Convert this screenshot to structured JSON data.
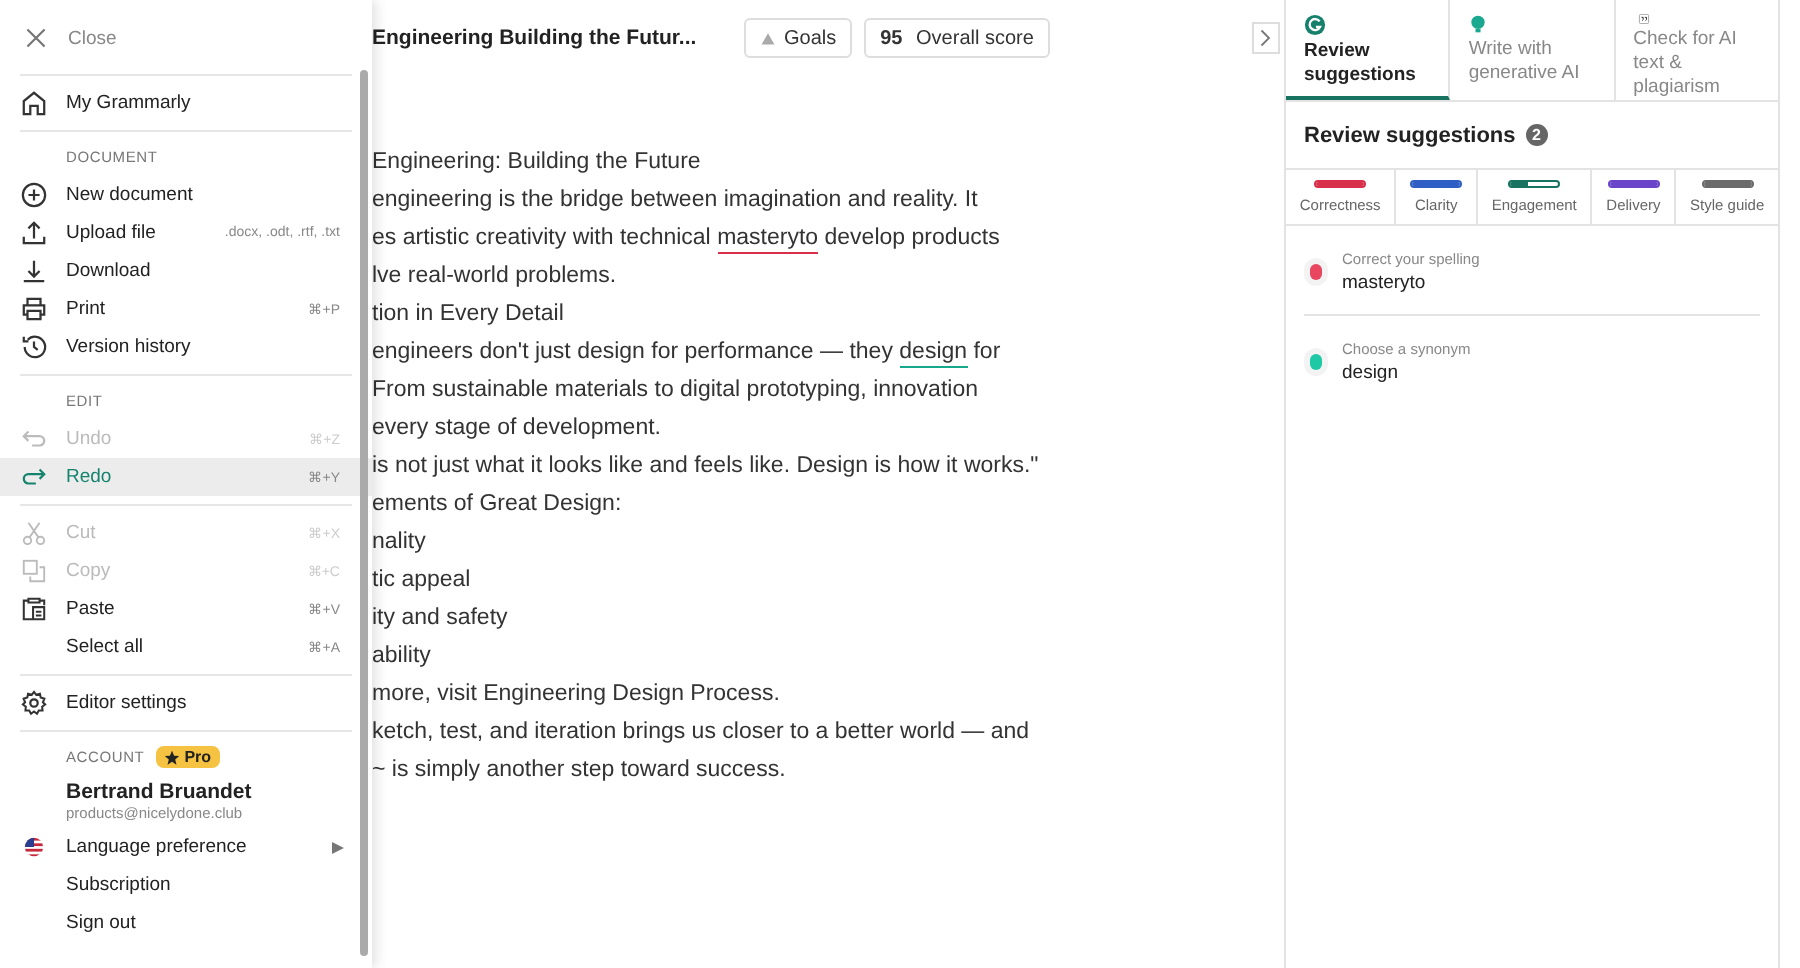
{
  "menu": {
    "close": "Close",
    "sections": [
      {
        "items": [
          {
            "label": "My Grammarly",
            "disabled": false,
            "selected": false
          }
        ]
      },
      {
        "header": "DOCUMENT",
        "items": [
          {
            "label": "New document",
            "disabled": false,
            "selected": false
          },
          {
            "label": "Upload file",
            "hint": ".docx, .odt, .rtf, .txt",
            "disabled": false,
            "selected": false
          },
          {
            "label": "Download",
            "disabled": false,
            "selected": false
          },
          {
            "label": "Print",
            "shortcut": "⌘+P",
            "disabled": false,
            "selected": false
          },
          {
            "label": "Version history",
            "disabled": false,
            "selected": false
          }
        ]
      },
      {
        "header": "EDIT",
        "items": [
          {
            "label": "Undo",
            "shortcut": "⌘+Z",
            "disabled": true,
            "selected": false
          },
          {
            "label": "Redo",
            "shortcut": "⌘+Y",
            "disabled": false,
            "selected": true
          }
        ]
      },
      {
        "items": [
          {
            "label": "Cut",
            "shortcut": "⌘+X",
            "disabled": true,
            "selected": false
          },
          {
            "label": "Copy",
            "shortcut": "⌘+C",
            "disabled": true,
            "selected": false
          },
          {
            "label": "Paste",
            "shortcut": "⌘+V",
            "disabled": false,
            "selected": false
          },
          {
            "label": "Select all",
            "shortcut": "⌘+A",
            "disabled": false,
            "selected": false
          }
        ]
      },
      {
        "items": [
          {
            "label": "Editor settings",
            "disabled": false,
            "selected": false
          }
        ]
      }
    ],
    "account": {
      "header": "ACCOUNT",
      "badge": "Pro",
      "name": "Bertrand Bruandet",
      "email": "products@nicelydone.club",
      "items": [
        {
          "label": "Language preference",
          "submenu": true
        },
        {
          "label": "Subscription",
          "submenu": false
        },
        {
          "label": "Sign out",
          "submenu": false
        }
      ]
    }
  },
  "editor": {
    "title": "Engineering Building the Futur...",
    "goals": "Goals",
    "score": "95",
    "score_label": "Overall score",
    "lines": [
      [
        {
          "text": "Engineering: Building the Future"
        }
      ],
      [
        {
          "text": "engineering is the bridge between imagination and reality. It"
        }
      ],
      [
        {
          "text": "es artistic creativity with technical "
        },
        {
          "text": "masteryto",
          "color": "#d8304a"
        },
        {
          "text": " develop products"
        }
      ],
      [
        {
          "text": "lve real-world problems."
        }
      ],
      [
        {
          "text": "tion in Every Detail"
        }
      ],
      [
        {
          "text": "engineers don't just design for performance — they "
        },
        {
          "text": "design",
          "color": "#15a88a"
        },
        {
          "text": " for"
        }
      ],
      [
        {
          "text": "From sustainable materials to digital prototyping, innovation"
        }
      ],
      [
        {
          "text": "every stage of development."
        }
      ],
      [
        {
          "text": "is not just what it looks like and feels like. Design is how it works.\""
        }
      ],
      [
        {
          "text": "ements of Great Design:"
        }
      ],
      [
        {
          "text": "nality"
        }
      ],
      [
        {
          "text": "tic appeal"
        }
      ],
      [
        {
          "text": "ity and safety"
        }
      ],
      [
        {
          "text": "ability"
        }
      ],
      [
        {
          "text": "more, visit Engineering Design Process."
        }
      ],
      [
        {
          "text": "ketch, test, and iteration brings us closer to a better world — and"
        }
      ],
      [
        {
          "text": "~ is simply another step toward success."
        }
      ]
    ]
  },
  "panel": {
    "tabs": [
      {
        "label": "Review suggestions",
        "selected": true
      },
      {
        "label": "Write with generative AI",
        "selected": false
      },
      {
        "label": "Check for AI text & plagiarism",
        "selected": false
      }
    ],
    "heading": "Review suggestions",
    "count": "2",
    "categories": [
      {
        "label": "Correctness",
        "color": "#d8304a",
        "level": 1
      },
      {
        "label": "Clarity",
        "color": "#2f5fc4",
        "level": 1
      },
      {
        "label": "Engagement",
        "color": "#17735f",
        "level": 0.35
      },
      {
        "label": "Delivery",
        "color": "#6a45c9",
        "level": 1
      },
      {
        "label": "Style guide",
        "color": "#6b6b6b",
        "level": 1
      }
    ],
    "suggestions": [
      {
        "title": "Correct your spelling",
        "word": "masteryto",
        "color": "#e8475f"
      },
      {
        "title": "Choose a synonym",
        "word": "design",
        "color": "#1fc9a5"
      }
    ]
  }
}
